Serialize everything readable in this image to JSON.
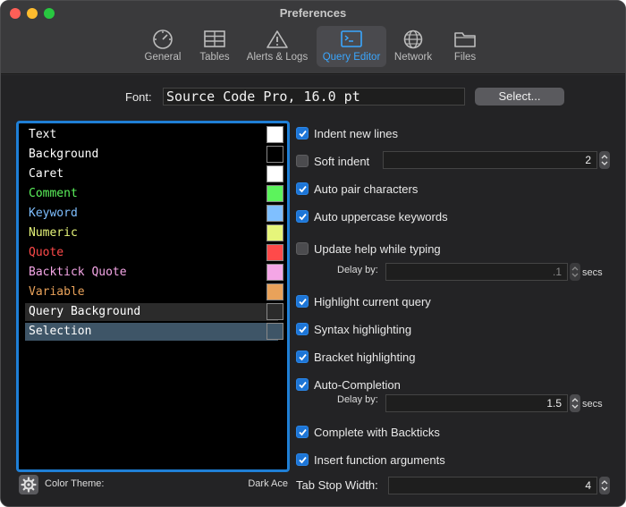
{
  "window": {
    "title": "Preferences"
  },
  "toolbar": {
    "items": [
      {
        "label": "General",
        "icon": "speedometer-icon"
      },
      {
        "label": "Tables",
        "icon": "table-icon"
      },
      {
        "label": "Alerts & Logs",
        "icon": "warning-triangle-icon"
      },
      {
        "label": "Query Editor",
        "icon": "terminal-icon",
        "active": true
      },
      {
        "label": "Network",
        "icon": "globe-icon"
      },
      {
        "label": "Files",
        "icon": "folder-icon"
      }
    ]
  },
  "font": {
    "label": "Font:",
    "value": "Source Code Pro, 16.0 pt",
    "select_label": "Select..."
  },
  "theme": {
    "elements": [
      {
        "name": "Text",
        "color": "#ffffff"
      },
      {
        "name": "Background",
        "color": "#000000"
      },
      {
        "name": "Caret",
        "color": "#ffffff"
      },
      {
        "name": "Comment",
        "color": "#5cf35c"
      },
      {
        "name": "Keyword",
        "color": "#7fbfff"
      },
      {
        "name": "Numeric",
        "color": "#e6f57a"
      },
      {
        "name": "Quote",
        "color": "#ff4a4a"
      },
      {
        "name": "Backtick Quote",
        "color": "#f4a6e6"
      },
      {
        "name": "Variable",
        "color": "#e9a25a"
      },
      {
        "name": "Query Background",
        "color": "#2b2b2b"
      },
      {
        "name": "Selection",
        "color": "#3e5567"
      }
    ],
    "color_theme_label": "Color Theme:",
    "color_theme_value": "Dark Ace"
  },
  "options": {
    "indent_new_lines": {
      "label": "Indent new lines",
      "checked": true
    },
    "soft_indent": {
      "label": "Soft indent",
      "checked": false,
      "value": "2"
    },
    "auto_pair": {
      "label": "Auto pair characters",
      "checked": true
    },
    "auto_uppercase": {
      "label": "Auto uppercase keywords",
      "checked": true
    },
    "update_help": {
      "label": "Update help while typing",
      "checked": false,
      "delay_label": "Delay by:",
      "delay_value": ".1",
      "units": "secs"
    },
    "highlight_query": {
      "label": "Highlight current query",
      "checked": true
    },
    "syntax_highlighting": {
      "label": "Syntax highlighting",
      "checked": true
    },
    "bracket_highlighting": {
      "label": "Bracket highlighting",
      "checked": true
    },
    "auto_completion": {
      "label": "Auto-Completion",
      "checked": true,
      "delay_label": "Delay by:",
      "delay_value": "1.5",
      "units": "secs"
    },
    "complete_backticks": {
      "label": "Complete with Backticks",
      "checked": true
    },
    "insert_function_args": {
      "label": "Insert function arguments",
      "checked": true
    },
    "tab_stop": {
      "label": "Tab Stop Width:",
      "value": "4"
    }
  },
  "colors": {
    "accent": "#1d75d6",
    "active_tab_text": "#3aa7ff"
  }
}
